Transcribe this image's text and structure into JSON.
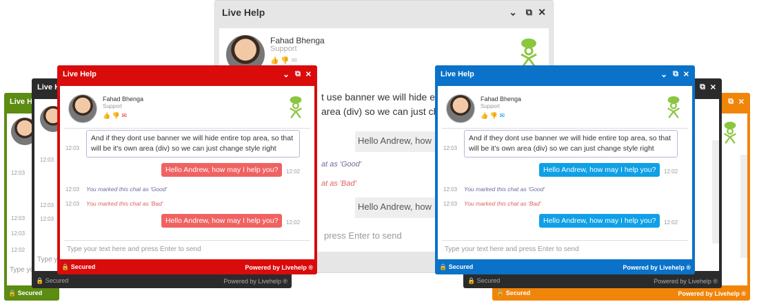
{
  "colors": {
    "green": "#5c8c12",
    "black": "#2b2b2b",
    "gray": "#e6e6e6",
    "red": "#d90b0b",
    "blue": "#0a72c8",
    "orange": "#f0850a",
    "red_bubble": "#f06262",
    "blue_bubble": "#0fa0e6",
    "note_good": "#6b6b9a",
    "note_bad": "#e06060"
  },
  "title": "Live Help",
  "title_partial": "Live He",
  "agent": {
    "name": "Fahad Bhenga",
    "role": "Support"
  },
  "icons": {
    "minimize": "chevron-down-icon",
    "popout": "popout-icon",
    "close": "close-icon",
    "like": "thumbs-up-icon",
    "dislike": "thumbs-down-icon",
    "email": "mail-icon",
    "lock": "lock-icon",
    "logo": "livehelp-logo-icon"
  },
  "messages": {
    "m1_text": "And if they dont use banner we will hide entire top area, so that will be it's own area (div) so we can just change style right",
    "m1_time": "12:03",
    "m2_text": "Hello Andrew, how may I help you?",
    "m2_time": "12:02",
    "note_good": "You marked this chat as 'Good'",
    "note_good_time": "12:03",
    "note_bad": "You marked this chat as 'Bad'",
    "note_bad_time": "12:03",
    "m3_text": "Hello Andrew, how may I help you?",
    "m3_time": "12:02"
  },
  "gray_window": {
    "banner_text": "t use banner we will hide en",
    "area_text": "area (div) so we can just ch",
    "hello_text": "Hello Andrew, how",
    "good_text": "at as 'Good'",
    "bad_text": "at as 'Bad'",
    "hello2_text": "Hello Andrew, how",
    "input_tail": "press Enter to send"
  },
  "input_placeholder": "Type your text here and press Enter to send",
  "input_partial": "Type yo",
  "footer": {
    "secured": "Secured",
    "powered": "Powered by Livehelp ®"
  }
}
